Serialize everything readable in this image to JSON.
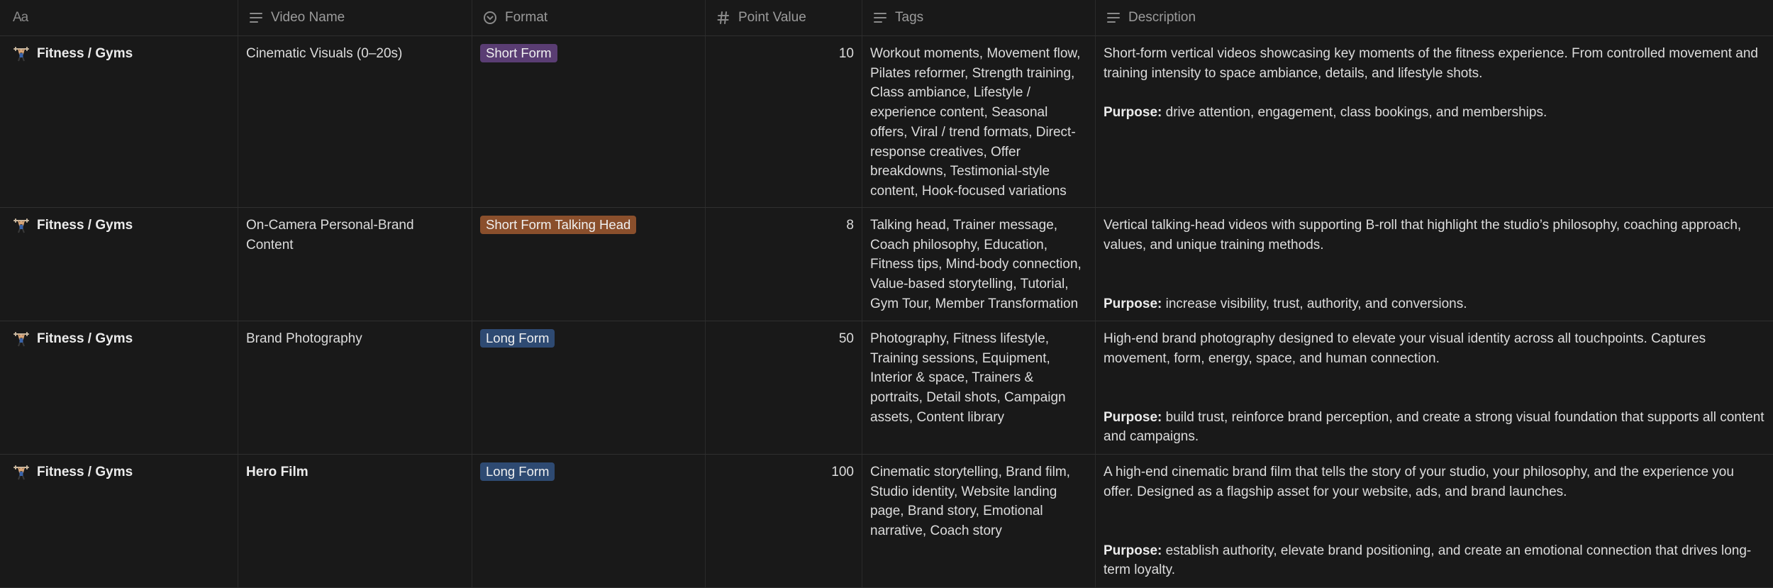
{
  "columns": [
    {
      "label": "Aa",
      "icon": "title-icon"
    },
    {
      "label": "Video Name",
      "icon": "text-lines-icon"
    },
    {
      "label": "Format",
      "icon": "select-circle-icon"
    },
    {
      "label": "Point Value",
      "icon": "hash-icon"
    },
    {
      "label": "Tags",
      "icon": "text-lines-icon"
    },
    {
      "label": "Description",
      "icon": "text-lines-icon"
    }
  ],
  "colors": {
    "short_form": "#5a3d73",
    "short_form_talking_head": "#8a4f2c",
    "long_form": "#2e4a72"
  },
  "rows": [
    {
      "name": "Fitness / Gyms",
      "emoji": "weightlifter-emoji",
      "video_name": "Cinematic Visuals (0–20s)",
      "format": "Short Form",
      "points": "10",
      "tags": "Workout moments, Movement flow, Pilates reformer, Strength training, Class ambiance, Lifestyle / experience content, Seasonal offers, Viral / trend formats, Direct-response creatives, Offer breakdowns, Testimonial-style content, Hook-focused variations",
      "desc_intro": "Short-form vertical videos showcasing key moments of the fitness experience. From controlled movement and training intensity to space ambiance, details, and lifestyle shots.",
      "purpose_label": "Purpose:",
      "purpose_text": "drive attention, engagement, class bookings, and memberships."
    },
    {
      "name": "Fitness / Gyms",
      "emoji": "weightlifter-emoji",
      "video_name": "On-Camera Personal-Brand Content",
      "format": "Short Form Talking Head",
      "points": "8",
      "tags": "Talking head, Trainer message, Coach philosophy, Education, Fitness tips, Mind-body connection, Value-based storytelling, Tutorial, Gym Tour, Member Transformation",
      "desc_intro": "Vertical talking-head videos with supporting B-roll that highlight the studio’s philosophy, coaching approach, values, and unique training methods.",
      "purpose_label": "Purpose:",
      "purpose_text": "increase visibility, trust, authority, and conversions."
    },
    {
      "name": "Fitness / Gyms",
      "emoji": "weightlifter-emoji",
      "video_name": "Brand Photography",
      "format": "Long Form",
      "points": "50",
      "tags": "Photography, Fitness lifestyle, Training sessions, Equipment, Interior & space, Trainers & portraits, Detail shots, Campaign assets, Content library",
      "desc_intro": "High-end brand photography designed to elevate your visual identity across all touchpoints. Captures movement, form, energy, space, and human connection.",
      "purpose_label": "Purpose:",
      "purpose_text": "build trust, reinforce brand perception, and create a strong visual foundation that supports all content and campaigns."
    },
    {
      "name": "Fitness / Gyms",
      "emoji": "weightlifter-emoji",
      "video_name": "Hero Film",
      "format": "Long Form",
      "points": "100",
      "tags": "Cinematic storytelling, Brand film, Studio identity, Website landing page, Brand story, Emotional narrative, Coach story",
      "desc_intro": "A high-end cinematic brand film that tells the story of your studio, your philosophy, and the experience you offer. Designed as a flagship asset for your website, ads, and brand launches.",
      "purpose_label": "Purpose:",
      "purpose_text": "establish authority, elevate brand positioning, and create an emotional connection that drives long-term loyalty."
    }
  ]
}
